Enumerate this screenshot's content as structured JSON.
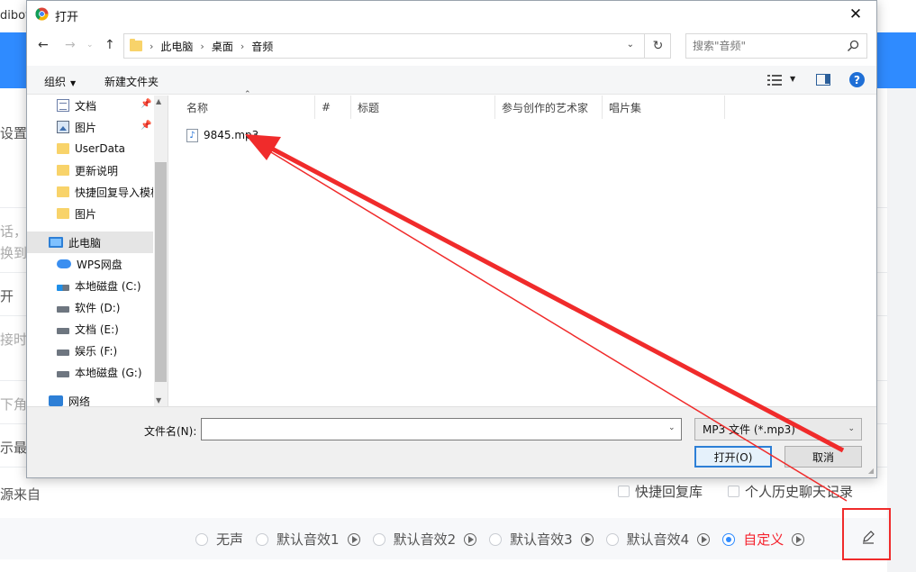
{
  "background": {
    "brand_fragment": "dibot",
    "fragments": [
      "设置",
      "话，",
      "换到",
      "开",
      "接时",
      "下角",
      "示最",
      "源来自"
    ],
    "checkboxes": [
      {
        "label": "快捷回复库"
      },
      {
        "label": "个人历史聊天记录"
      }
    ],
    "sound_options": [
      {
        "label": "无声",
        "selected": false,
        "has_play": false
      },
      {
        "label": "默认音效1",
        "selected": false,
        "has_play": true
      },
      {
        "label": "默认音效2",
        "selected": false,
        "has_play": true
      },
      {
        "label": "默认音效3",
        "selected": false,
        "has_play": true
      },
      {
        "label": "默认音效4",
        "selected": false,
        "has_play": true
      },
      {
        "label": "自定义",
        "selected": true,
        "has_play": true
      }
    ],
    "edit_icon": "pen-icon",
    "accent_color": "#2f8bff",
    "highlight_color": "#f02b2b"
  },
  "dialog": {
    "title": "打开",
    "title_icon": "chrome-icon",
    "breadcrumb": [
      "此电脑",
      "桌面",
      "音频"
    ],
    "search_placeholder": "搜索\"音频\"",
    "toolbar": {
      "organize": "组织",
      "new_folder": "新建文件夹"
    },
    "nav_items": [
      {
        "label": "文档",
        "icon": "document-icon",
        "pinned": true
      },
      {
        "label": "图片",
        "icon": "picture-icon",
        "pinned": true
      },
      {
        "label": "UserData",
        "icon": "folder-icon",
        "pinned": false
      },
      {
        "label": "更新说明",
        "icon": "folder-icon",
        "pinned": false
      },
      {
        "label": "快捷回复导入模板",
        "icon": "folder-icon",
        "pinned": false
      },
      {
        "label": "图片",
        "icon": "folder-icon",
        "pinned": false
      },
      {
        "label": "此电脑",
        "icon": "computer-icon",
        "pinned": false
      },
      {
        "label": "WPS网盘",
        "icon": "cloud-icon",
        "pinned": false
      },
      {
        "label": "本地磁盘 (C:)",
        "icon": "drive-icon",
        "pinned": false
      },
      {
        "label": "软件 (D:)",
        "icon": "drive-icon",
        "pinned": false
      },
      {
        "label": "文档 (E:)",
        "icon": "drive-icon",
        "pinned": false
      },
      {
        "label": "娱乐 (F:)",
        "icon": "drive-icon",
        "pinned": false
      },
      {
        "label": "本地磁盘 (G:)",
        "icon": "drive-icon",
        "pinned": false
      },
      {
        "label": "网络",
        "icon": "network-icon",
        "pinned": false
      }
    ],
    "columns": [
      "名称",
      "#",
      "标题",
      "参与创作的艺术家",
      "唱片集"
    ],
    "files": [
      {
        "name": "9845.mp3",
        "icon": "audio-file-icon"
      }
    ],
    "filename_label": "文件名(N):",
    "filename_value": "",
    "filetype": "MP3 文件 (*.mp3)",
    "open_button": "打开(O)",
    "cancel_button": "取消"
  }
}
